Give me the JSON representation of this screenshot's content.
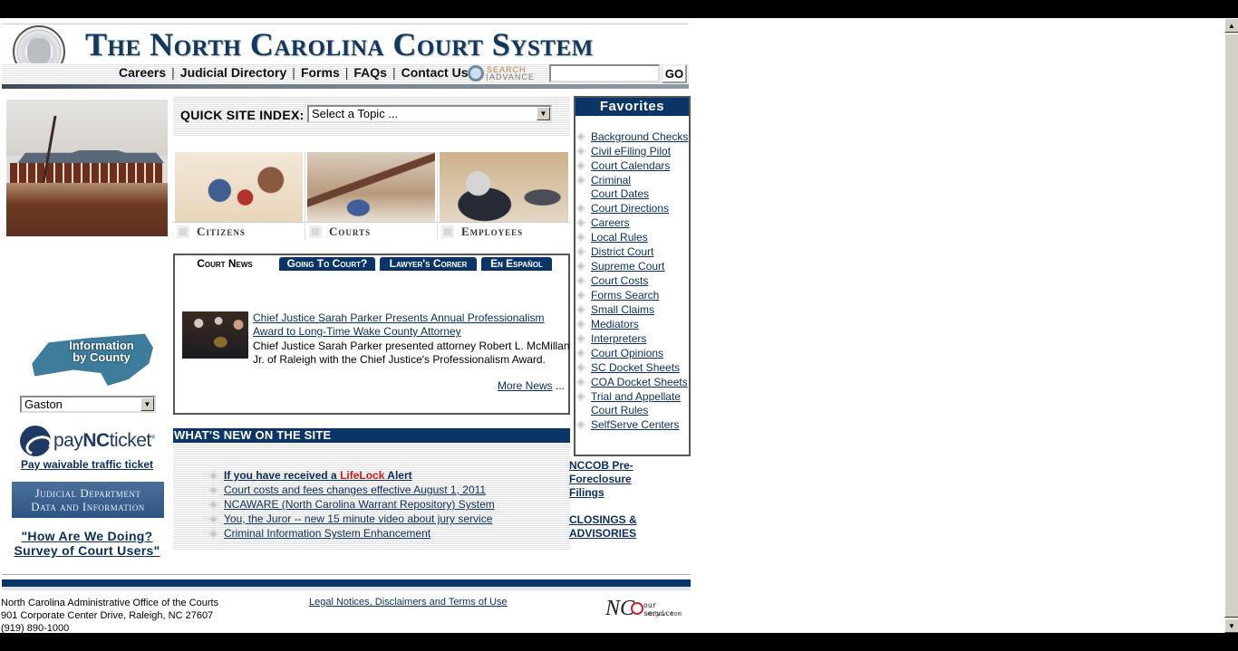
{
  "header": {
    "title": "The North Carolina Court System",
    "nav": [
      "Careers",
      "Judicial Directory",
      "Forms",
      "FAQs",
      "Contact Us"
    ],
    "nav_separator": "|",
    "search_logo_top": "SEARCH",
    "search_logo_bottom": "ADVANCE",
    "search_input_value": "",
    "go_label": "GO"
  },
  "quick_index": {
    "label": "QUICK SITE INDEX:",
    "selected": "Select a Topic ..."
  },
  "portals": [
    {
      "label": "Citizens",
      "icon": "citizens-photo"
    },
    {
      "label": "Courts",
      "icon": "gavel-photo"
    },
    {
      "label": "Employees",
      "icon": "employee-photo"
    }
  ],
  "news": {
    "tabs": [
      "Court News",
      "Going To Court?",
      "Lawyer's Corner",
      "En Español"
    ],
    "active_tab": "Court News",
    "headline": "Chief Justice Sarah Parker Presents Annual Professionalism Award to Long-Time Wake County Attorney",
    "body": "Chief Justice Sarah Parker presented attorney Robert L. McMillan Jr. of Raleigh with the Chief Justice's Professionalism Award.",
    "more_label": "More News",
    "more_suffix": " ..."
  },
  "whats_new": {
    "title": "WHAT'S NEW ON THE SITE",
    "lifelock_prefix": "If you have received a ",
    "lifelock_brand": "LifeLock",
    "lifelock_suffix": " Alert",
    "items": [
      "Court costs and fees changes effective August 1, 2011",
      "NCAWARE (North Carolina Warrant Repository) System",
      "You, the Juror -- new 15 minute video about jury service",
      "Criminal Information System Enhancement"
    ]
  },
  "left": {
    "map_label_line1": "Information",
    "map_label_line2": "by County",
    "county_selected": "Gaston",
    "paync_pre": "pay",
    "paync_bold": "NC",
    "paync_post": "ticket",
    "paync_reg": "®",
    "pay_link": "Pay waivable traffic ticket",
    "judicial_line1": "Judicial Department",
    "judicial_line2": "Data and Information",
    "survey_line1": "\"How Are We Doing?",
    "survey_line2": "Survey of Court Users\""
  },
  "favorites": {
    "title": "Favorites",
    "items": [
      "Background Checks",
      "Civil eFiling Pilot",
      "Court Calendars",
      "Criminal Court Dates",
      "Court Directions",
      "Careers",
      "Local Rules",
      "District Court",
      "Supreme Court",
      "Court Costs",
      "Forms Search",
      "Small Claims",
      "Mediators",
      "Interpreters",
      "Court Opinions",
      "SC Docket Sheets",
      "COA Docket Sheets",
      "Trial and Appellate Court Rules",
      "SelfServe Centers"
    ],
    "nccob_link": "NCCOB Pre-Foreclosure Filings",
    "closings_link": "CLOSINGS & ADVISORIES"
  },
  "footer": {
    "address_line1": "North Carolina Administrative Office of the Courts",
    "address_line2": "901 Corporate Center Drive, Raleigh, NC 27607",
    "address_line3": "(919) 890-1000",
    "legal_link": "Legal Notices, Disclaimers and Terms of Use",
    "ncgov_mark": "NC",
    "ncgov_tag": "our service",
    "ncgov_site": "ncgov.com"
  },
  "colors": {
    "brand_navy": "#0b3566",
    "link": "#0b2d5a",
    "lifelock_red": "#c71b1b"
  }
}
